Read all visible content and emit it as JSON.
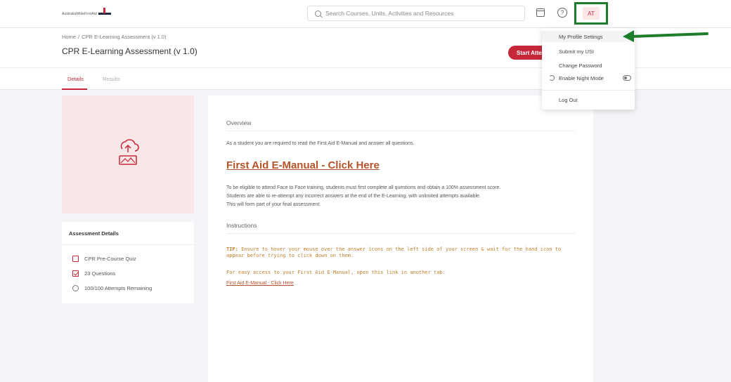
{
  "logo": {
    "text": "AustraliaWideFirstAid"
  },
  "search": {
    "placeholder": "Search Courses, Units, Activities and Resources"
  },
  "user": {
    "initials": "AT"
  },
  "breadcrumb": {
    "home": "Home",
    "separator": "/",
    "current": "CPR E-Learning Assessment (v 1.0)"
  },
  "page": {
    "title": "CPR E-Learning Assessment (v 1.0)",
    "start_button": "Start Attempt"
  },
  "tabs": [
    {
      "label": "Details"
    },
    {
      "label": "Results"
    }
  ],
  "details": {
    "title": "Assessment Details",
    "items": [
      {
        "icon": "clipboard-icon",
        "label": "CPR Pre-Course Quiz"
      },
      {
        "icon": "checkbox-icon",
        "label": "23 Questions"
      },
      {
        "icon": "circle-icon",
        "label": "100/100 Attempts Remaining"
      }
    ]
  },
  "content": {
    "overview_heading": "Overview",
    "intro": "As a student you are required to read the First Aid E-Manual and answer all questions.",
    "manual_link": "First Aid E-Manual - Click Here",
    "para1": "To be eligible to attend Face to Face training, students must first complete all questions and obtain a 100% assessment score.",
    "para2": "Students are able to re-attempt any incorrect answers at the end of the E-Learning, with unlimited attempts available.",
    "para3": "This will form part of your final assessment.",
    "instructions_heading": "Instructions",
    "tip_label": "TIP:",
    "tip_text": " Ensure to hover your mouse over the answer icons on the left side of your screen & wait for the hand icon to appear before trying to click down on them.",
    "easy_access": "For easy access to your First Aid E-Manual, open this link in another tab:",
    "small_link": "First Aid E-Manual - Click Here"
  },
  "dropdown": {
    "profile": "My Profile Settings",
    "usi": "Submit my USI",
    "password": "Change Password",
    "night_mode": "Enable Night Mode",
    "logout": "Log Out"
  },
  "colors": {
    "accent": "#c6283a",
    "highlight_border": "#1e7d2a",
    "link": "#b5532a",
    "tip": "#c07f2c"
  }
}
